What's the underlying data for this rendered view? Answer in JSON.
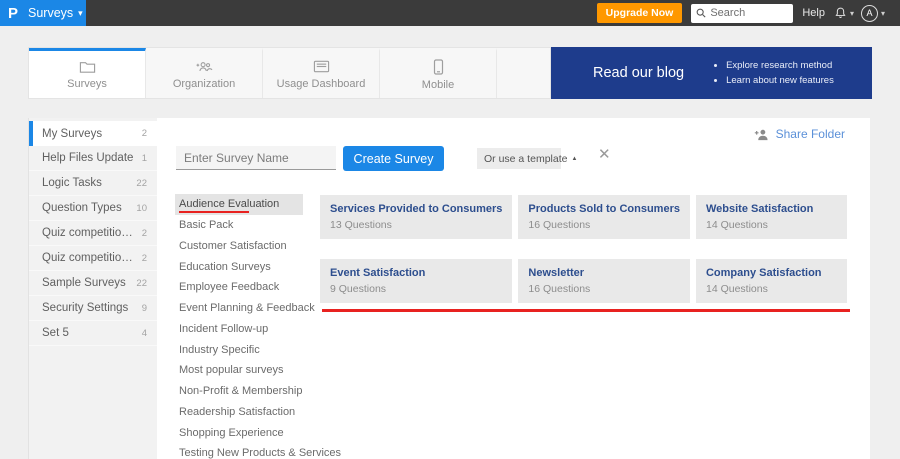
{
  "topbar": {
    "logo_letter": "P",
    "product_menu": "Surveys",
    "upgrade_button": "Upgrade Now",
    "search_placeholder": "Search",
    "help_label": "Help",
    "avatar_letter": "A"
  },
  "icons": {
    "caret_down": "▾",
    "caret_up": "▲",
    "close": "✕"
  },
  "tabs": [
    {
      "label": "Surveys",
      "icon": "folder-icon",
      "active": true
    },
    {
      "label": "Organization",
      "icon": "people-add-icon",
      "active": false
    },
    {
      "label": "Usage Dashboard",
      "icon": "dashboard-icon",
      "active": false
    },
    {
      "label": "Mobile",
      "icon": "mobile-icon",
      "active": false
    }
  ],
  "blog_banner": {
    "title": "Read our blog",
    "bullets": [
      "Explore research method",
      "Learn about new features"
    ]
  },
  "sidebar": {
    "items": [
      {
        "label": "My Surveys",
        "count": "2",
        "active": true
      },
      {
        "label": "Help Files Update",
        "count": "1",
        "active": false
      },
      {
        "label": "Logic Tasks",
        "count": "22",
        "active": false
      },
      {
        "label": "Question Types",
        "count": "10",
        "active": false
      },
      {
        "label": "Quiz competition - ...",
        "count": "2",
        "active": false
      },
      {
        "label": "Quiz competition - ...",
        "count": "2",
        "active": false
      },
      {
        "label": "Sample Surveys",
        "count": "22",
        "active": false
      },
      {
        "label": "Security Settings",
        "count": "9",
        "active": false
      },
      {
        "label": "Set 5",
        "count": "4",
        "active": false
      }
    ]
  },
  "main": {
    "share_folder_label": "Share Folder",
    "survey_name_placeholder": "Enter Survey Name",
    "create_button": "Create Survey",
    "template_dropdown": "Or use a template",
    "selected_category": "Audience Evaluation",
    "categories": [
      "Audience Evaluation",
      "Basic Pack",
      "Customer Satisfaction",
      "Education Surveys",
      "Employee Feedback",
      "Event Planning & Feedback",
      "Incident Follow-up",
      "Industry Specific",
      "Most popular surveys",
      "Non-Profit & Membership",
      "Readership Satisfaction",
      "Shopping Experience",
      "Testing New Products & Services"
    ],
    "templates": [
      {
        "title": "Services Provided to Consumers",
        "questions": "13 Questions"
      },
      {
        "title": "Products Sold to Consumers",
        "questions": "16 Questions"
      },
      {
        "title": "Website Satisfaction",
        "questions": "14 Questions"
      },
      {
        "title": "Event Satisfaction",
        "questions": "9 Questions"
      },
      {
        "title": "Newsletter",
        "questions": "16 Questions"
      },
      {
        "title": "Company Satisfaction",
        "questions": "14 Questions"
      }
    ]
  },
  "colors": {
    "accent-blue": "#1b87e6",
    "topbar-bg": "#3b3b3b",
    "orange": "#ff9800",
    "navy": "#1e3c8c",
    "page-bg": "#efefef",
    "card-navy": "#2d4e8e",
    "link-blue": "#5b90d8",
    "annotation-red": "#e82220"
  }
}
